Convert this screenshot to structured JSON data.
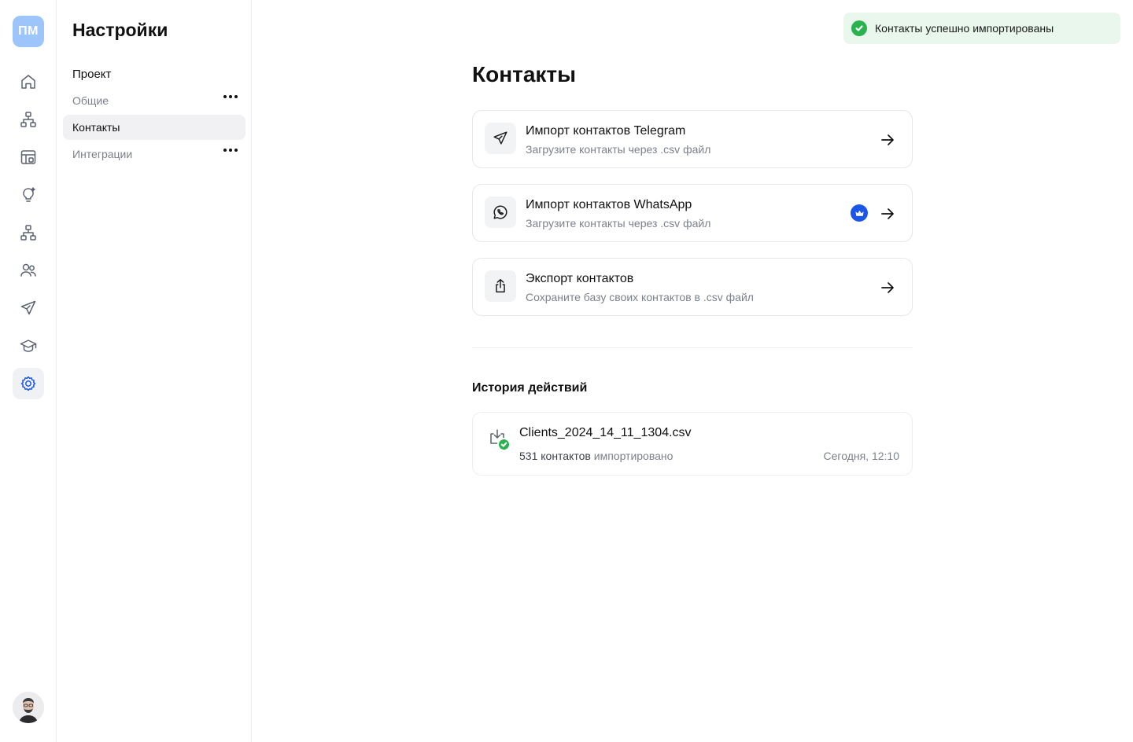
{
  "rail": {
    "logo_text": "ПМ",
    "items": [
      {
        "icon": "home-icon"
      },
      {
        "icon": "structure-icon"
      },
      {
        "icon": "layout-icon"
      },
      {
        "icon": "idea-bulb-icon"
      },
      {
        "icon": "hierarchy-icon"
      },
      {
        "icon": "users-icon"
      },
      {
        "icon": "send-icon"
      },
      {
        "icon": "graduation-cap-icon"
      },
      {
        "icon": "settings-gear-icon",
        "active": true
      }
    ]
  },
  "settings": {
    "title": "Настройки",
    "section_label": "Проект",
    "menu": [
      {
        "label": "Общие"
      },
      {
        "label": "Контакты",
        "active": true
      },
      {
        "label": "Интеграции"
      }
    ]
  },
  "toast": {
    "text": "Контакты успешно импортированы",
    "color": "#2ab24e"
  },
  "main": {
    "title": "Контакты",
    "cards": [
      {
        "title": "Импорт контактов Telegram",
        "subtitle": "Загрузите контакты через .csv файл",
        "icon": "paper-plane-icon"
      },
      {
        "title": "Импорт контактов WhatsApp",
        "subtitle": "Загрузите контакты через .csv файл",
        "icon": "whatsapp-icon",
        "premium_icon": "crown-icon"
      },
      {
        "title": "Экспорт контактов",
        "subtitle": "Сохраните базу своих контактов в .csv файл",
        "icon": "share-upload-icon"
      }
    ],
    "history": {
      "title": "История действий",
      "items": [
        {
          "file": "Clients_2024_14_11_1304.csv",
          "count": "531 контактов",
          "status": "импортировано",
          "time": "Сегодня, 12:10"
        }
      ]
    }
  },
  "colors": {
    "accent": "#1a57e8",
    "logo_bg": "#9cc5fb",
    "success": "#2ab24e",
    "toast_bg": "#e9f7ed"
  }
}
